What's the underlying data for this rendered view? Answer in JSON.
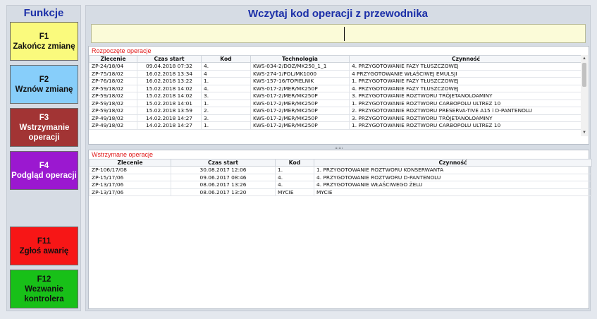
{
  "functions": {
    "title": "Funkcje",
    "buttons": [
      {
        "key": "F1",
        "label": "Zakończ zmianę",
        "color": "#fafa7d",
        "textColor": "#111111"
      },
      {
        "key": "F2",
        "label": "Wznów zmianę",
        "color": "#87cefa",
        "textColor": "#111111"
      },
      {
        "key": "F3",
        "label": "Wstrzymanie operacji",
        "color": "#a23434",
        "textColor": "#ffffff"
      },
      {
        "key": "F4",
        "label": "Podgląd operacji",
        "color": "#9b18d0",
        "textColor": "#ffffff"
      },
      {
        "key": "F11",
        "label": "Zgłoś awarię",
        "color": "#f71616",
        "textColor": "#111111"
      },
      {
        "key": "F12",
        "label": "Wezwanie kontrolera",
        "color": "#18c018",
        "textColor": "#111111"
      }
    ]
  },
  "main": {
    "title": "Wczytaj kod operacji z przewodnika",
    "scan_value": ""
  },
  "started": {
    "caption": "Rozpoczęte operacje",
    "columns": [
      "Zlecenie",
      "Czas start",
      "Kod",
      "Technologia",
      "Czynność"
    ],
    "rows": [
      [
        "ZP-24/18/04",
        "09.04.2018 07:32",
        "4.",
        "KWS-034-2/DOZ/MK250_1_1",
        "4. PRZYGOTOWANIE FAZY TŁUSZCZOWEJ"
      ],
      [
        "ZP-75/18/02",
        "16.02.2018 13:34",
        "4",
        "KWS-274-1/POL/MK1000",
        "4 PRZYGOTOWANIE WŁAŚCIWEJ EMULSJI"
      ],
      [
        "ZP-76/18/02",
        "16.02.2018 13:22",
        "1.",
        "KWS-157-16/TOPIELNIK",
        "1. PRZYGOTOWANIE FAZY TŁUSZCZOWEJ"
      ],
      [
        "ZP-59/18/02",
        "15.02.2018 14:02",
        "4.",
        "KWS-017-2/MER/MK250P",
        "4. PRZYGOTOWANIE FAZY TŁUSZCZOWEJ"
      ],
      [
        "ZP-59/18/02",
        "15.02.2018 14:02",
        "3.",
        "KWS-017-2/MER/MK250P",
        "3. PRZYGOTOWANIE ROZTWORU TRÓJETANOLOAMINY"
      ],
      [
        "ZP-59/18/02",
        "15.02.2018 14:01",
        "1.",
        "KWS-017-2/MER/MK250P",
        "1. PRZYGOTOWANIE ROZTWORU CARBOPOLU ULTREZ 10"
      ],
      [
        "ZP-59/18/02",
        "15.02.2018 13:59",
        "2.",
        "KWS-017-2/MER/MK250P",
        "2. PRZYGOTOWANIE  ROZTWORU PRESERVA-TIVE A15 i D-PANTENOLU"
      ],
      [
        "ZP-49/18/02",
        "14.02.2018 14:27",
        "3.",
        "KWS-017-2/MER/MK250P",
        "3. PRZYGOTOWANIE ROZTWORU TRÓJETANOLOAMINY"
      ],
      [
        "ZP-49/18/02",
        "14.02.2018 14:27",
        "1.",
        "KWS-017-2/MER/MK250P",
        "1. PRZYGOTOWANIE ROZTWORU CARBOPOLU ULTREZ 10"
      ]
    ]
  },
  "paused": {
    "caption": "Wstrzymane operacje",
    "columns": [
      "Zlecenie",
      "Czas start",
      "Kod",
      "Czynność"
    ],
    "rows": [
      [
        "ZP-106/17/08",
        "30.08.2017 12:06",
        "1.",
        "1. PRZYGOTOWANIE ROZTWORU KONSERWANTA"
      ],
      [
        "ZP-15/17/06",
        "09.06.2017 08:46",
        "4.",
        "4. PRZYGOTOWANIE  ROZTWORU D-PANTENOLU"
      ],
      [
        "ZP-13/17/06",
        "08.06.2017 13:26",
        "4.",
        "4. PRZYGOTOWANIE WŁAŚCIWEGO ŻELU"
      ],
      [
        "ZP-13/17/06",
        "08.06.2017 13:20",
        "MYCIE",
        "MYCIE"
      ]
    ]
  }
}
